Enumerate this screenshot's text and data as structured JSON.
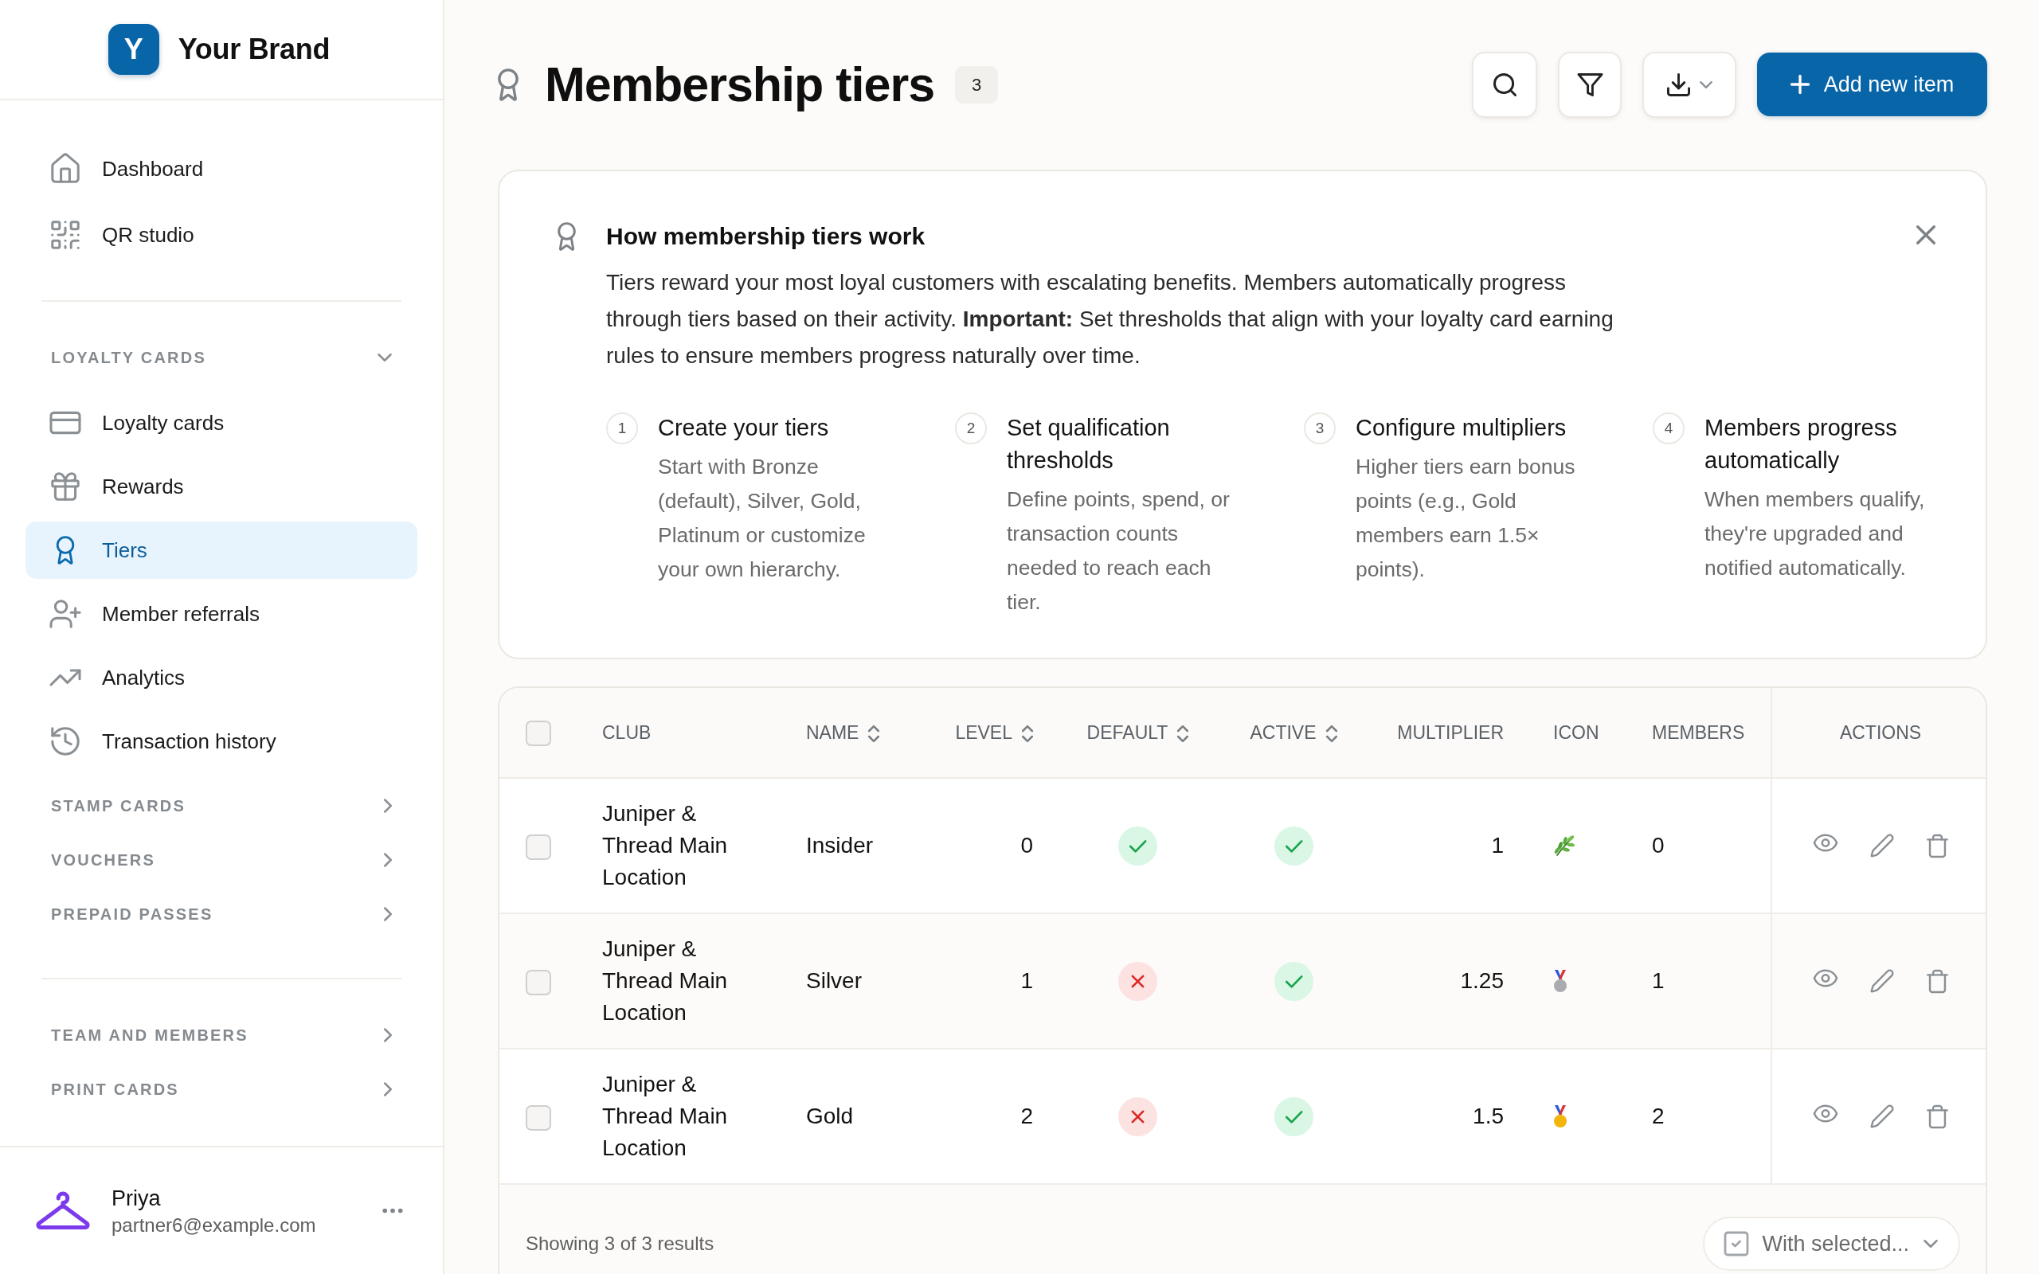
{
  "sidebar": {
    "brand": {
      "logo_letter": "Y",
      "name": "Your Brand"
    },
    "groups": [
      {
        "sections": [
          {
            "items": [
              {
                "label": "Dashboard",
                "selected": false
              },
              {
                "label": "QR studio",
                "selected": false
              }
            ]
          }
        ]
      },
      {
        "sections": [
          {
            "title": "LOYALTY CARDS",
            "expanded": true,
            "items": [
              {
                "label": "Loyalty cards",
                "selected": false
              },
              {
                "label": "Rewards",
                "selected": false
              },
              {
                "label": "Tiers",
                "selected": true
              },
              {
                "label": "Member referrals",
                "selected": false
              },
              {
                "label": "Analytics",
                "selected": false
              },
              {
                "label": "Transaction history",
                "selected": false
              }
            ]
          },
          {
            "title": "STAMP CARDS",
            "expanded": false
          },
          {
            "title": "VOUCHERS",
            "expanded": false
          },
          {
            "title": "PREPAID PASSES",
            "expanded": false
          }
        ]
      },
      {
        "sections": [
          {
            "title": "TEAM AND MEMBERS",
            "expanded": false
          },
          {
            "title": "PRINT CARDS",
            "expanded": false
          }
        ]
      }
    ],
    "user": {
      "name": "Priya",
      "email": "partner6@example.com"
    }
  },
  "header": {
    "title": "Membership tiers",
    "count": "3",
    "add_button": "Add new item"
  },
  "info_panel": {
    "title": "How membership tiers work",
    "text": "Tiers reward your most loyal customers with escalating benefits. Members automatically progress through tiers based on their activity. **Important:** Set thresholds that align with your loyalty card earning rules to ensure members progress naturally over time.",
    "steps": [
      {
        "number": "1",
        "title": "Create your tiers",
        "description": "Start with Bronze (default), Silver, Gold, Platinum or customize your own hierarchy."
      },
      {
        "number": "2",
        "title": "Set qualification thresholds",
        "description": "Define points, spend, or transaction counts needed to reach each tier."
      },
      {
        "number": "3",
        "title": "Configure multipliers",
        "description": "Higher tiers earn bonus points (e.g., Gold members earn 1.5× points)."
      },
      {
        "number": "4",
        "title": "Members progress automatically",
        "description": "When members qualify, they're upgraded and notified automatically."
      }
    ]
  },
  "table": {
    "select_all": {
      "checked": false
    },
    "columns": [
      {
        "label": "CLUB",
        "sortable": false
      },
      {
        "label": "NAME",
        "sortable": true
      },
      {
        "label": "LEVEL",
        "sortable": true
      },
      {
        "label": "DEFAULT",
        "sortable": true
      },
      {
        "label": "ACTIVE",
        "sortable": true
      },
      {
        "label": "MULTIPLIER",
        "sortable": false
      },
      {
        "label": "ICON",
        "sortable": false
      },
      {
        "label": "MEMBERS",
        "sortable": false
      },
      {
        "label": "ACTIONS",
        "sortable": false
      }
    ],
    "rows": [
      {
        "checked": false,
        "club": "Juniper & Thread Main Location",
        "name": "Insider",
        "level": "0",
        "default": true,
        "active": true,
        "multiplier": "1",
        "icon": {
          "kind": "herb"
        },
        "members": "0"
      },
      {
        "checked": false,
        "club": "Juniper & Thread Main Location",
        "name": "Silver",
        "level": "1",
        "default": false,
        "active": true,
        "multiplier": "1.25",
        "icon": {
          "kind": "medal",
          "color": "#a9abae"
        },
        "members": "1"
      },
      {
        "checked": false,
        "club": "Juniper & Thread Main Location",
        "name": "Gold",
        "level": "2",
        "default": false,
        "active": true,
        "multiplier": "1.5",
        "icon": {
          "kind": "medal",
          "color": "#f2b50c"
        },
        "members": "2"
      }
    ],
    "footer": {
      "summary": "Showing 3 of 3 results",
      "bulk_action": "With selected..."
    }
  }
}
